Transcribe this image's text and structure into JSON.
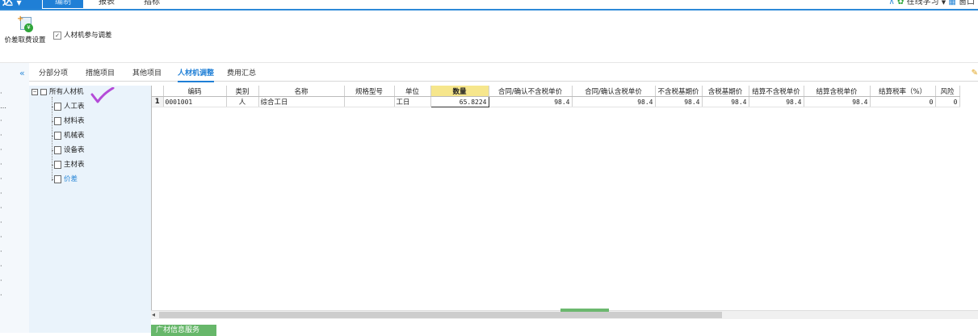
{
  "app": {
    "brand": "达"
  },
  "menu": {
    "tabs": [
      "编制",
      "报表",
      "指标"
    ],
    "active_index": 0
  },
  "topright": {
    "online_learning": "在线学习",
    "window": "窗口"
  },
  "toolbar": {
    "price_diff_settings": "价差取费设置",
    "labor_material_machine_adjust": "人材机参与调差",
    "checkbox_checked": true
  },
  "tabs": [
    "分部分项",
    "措施项目",
    "其他项目",
    "人材机调整",
    "费用汇总"
  ],
  "active_tab": 3,
  "tree": {
    "root": "所有人材机",
    "items": [
      "人工表",
      "材料表",
      "机械表",
      "设备表",
      "主材表",
      "价差"
    ],
    "selected": "价差"
  },
  "grid": {
    "columns": [
      "编码",
      "类别",
      "名称",
      "规格型号",
      "单位",
      "数量",
      "合同/确认不含税单价",
      "合同/确认含税单价",
      "不含税基期价",
      "含税基期价",
      "结算不含税单价",
      "结算含税单价",
      "结算税率（%）",
      "风险"
    ],
    "rows": [
      {
        "index": "1",
        "code": "0001001",
        "category": "人",
        "name": "综合工日",
        "spec": "",
        "unit": "工日",
        "qty": "65.8224",
        "contract_excl": "98.4",
        "contract_incl": "98.4",
        "base_excl": "98.4",
        "base_incl": "98.4",
        "settle_excl": "98.4",
        "settle_incl": "98.4",
        "settle_tax": "0",
        "risk": "0"
      }
    ]
  },
  "bottom": {
    "button": "广材信息服务"
  },
  "colors": {
    "accent": "#1f7fd6",
    "tree_bg": "#eaf3fb",
    "qty_header": "#f6e68c",
    "checkmark": "#b44bd8",
    "bottom_button": "#67b76a"
  }
}
